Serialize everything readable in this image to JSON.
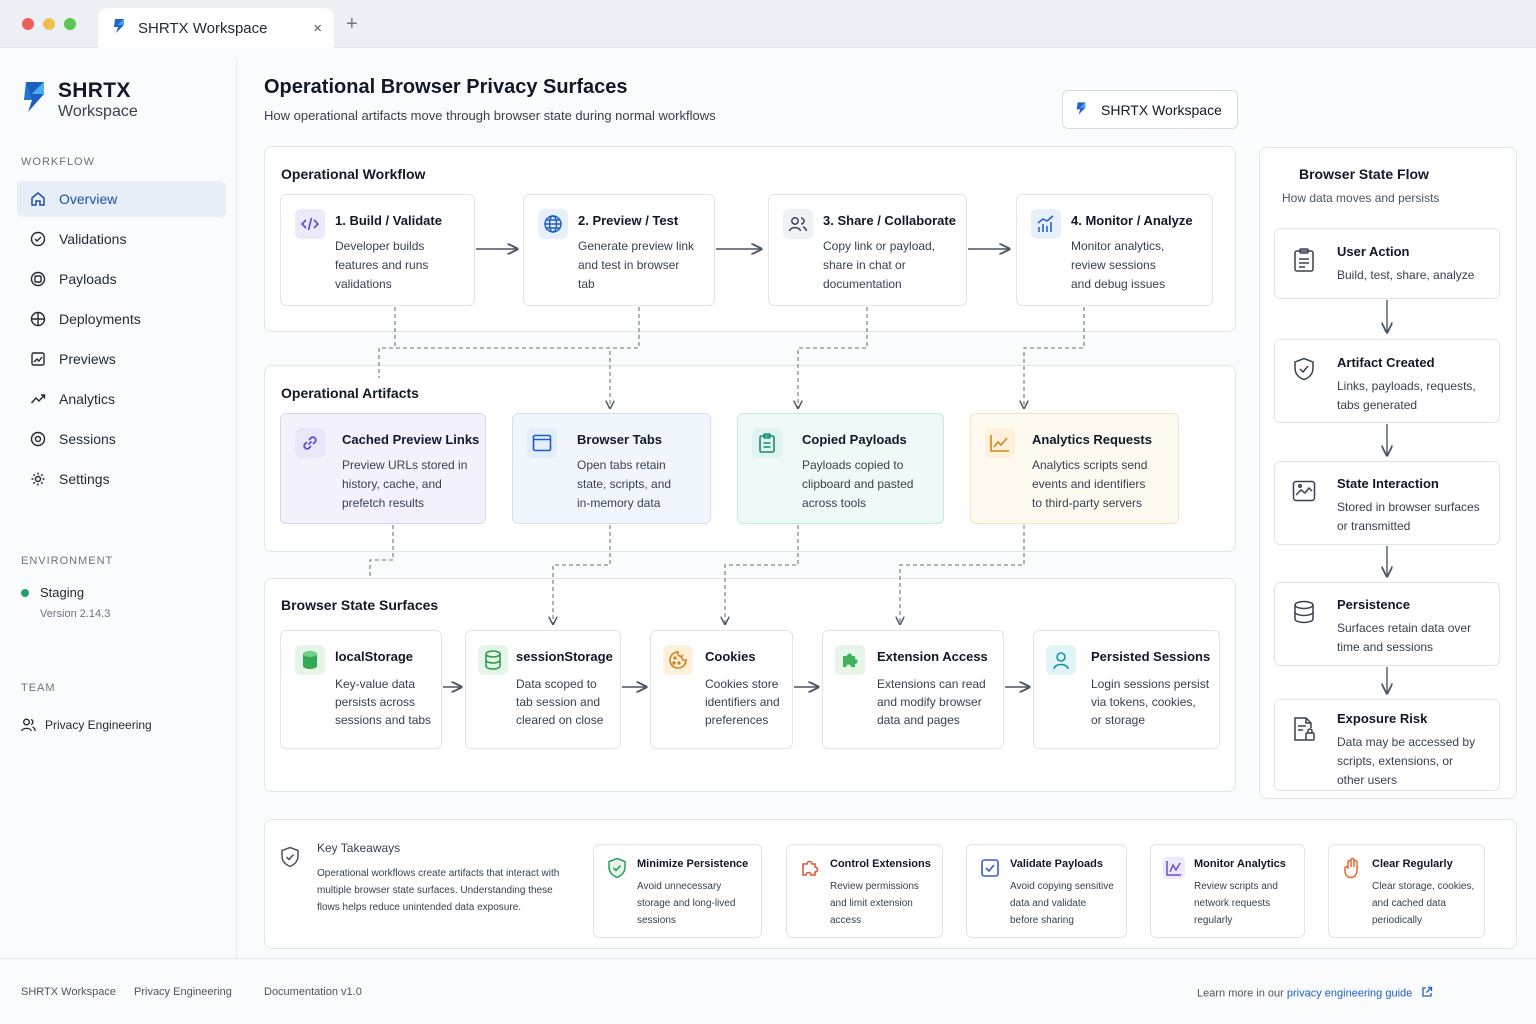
{
  "browser": {
    "tab_title": "SHRTX Workspace",
    "close": "×",
    "new_tab": "+"
  },
  "brand": {
    "name": "SHRTX",
    "sub": "Workspace"
  },
  "sidebar": {
    "workflow_label": "WORKFLOW",
    "items": [
      {
        "label": "Overview",
        "icon": "home-icon"
      },
      {
        "label": "Validations",
        "icon": "check-circle-icon"
      },
      {
        "label": "Payloads",
        "icon": "package-icon"
      },
      {
        "label": "Deployments",
        "icon": "globe-icon"
      },
      {
        "label": "Previews",
        "icon": "preview-icon"
      },
      {
        "label": "Analytics",
        "icon": "trend-icon"
      },
      {
        "label": "Sessions",
        "icon": "target-icon"
      },
      {
        "label": "Settings",
        "icon": "gear-icon"
      }
    ],
    "environment_label": "ENVIRONMENT",
    "env_name": "Staging",
    "env_version": "Version 2.14.3",
    "team_label": "TEAM",
    "team_name": "Privacy Engineering"
  },
  "header": {
    "title": "Operational Browser Privacy Surfaces",
    "subtitle": "How operational artifacts move through browser state during normal workflows",
    "workspace_button": "SHRTX Workspace"
  },
  "workflow": {
    "title": "Operational Workflow",
    "steps": [
      {
        "title": "1. Build / Validate",
        "lines": [
          "Developer builds",
          "features and runs",
          "validations"
        ]
      },
      {
        "title": "2. Preview / Test",
        "lines": [
          "Generate preview link",
          "and test in browser",
          "tab"
        ]
      },
      {
        "title": "3. Share / Collaborate",
        "lines": [
          "Copy link or payload,",
          "share in chat or",
          "documentation"
        ]
      },
      {
        "title": "4. Monitor / Analyze",
        "lines": [
          "Monitor analytics,",
          "review sessions",
          "and debug issues"
        ]
      }
    ]
  },
  "artifacts": {
    "title": "Operational Artifacts",
    "items": [
      {
        "title": "Cached Preview Links",
        "lines": [
          "Preview URLs stored in",
          "history, cache, and",
          "prefetch results"
        ]
      },
      {
        "title": "Browser Tabs",
        "lines": [
          "Open tabs retain",
          "state, scripts, and",
          "in-memory data"
        ]
      },
      {
        "title": "Copied Payloads",
        "lines": [
          "Payloads copied to",
          "clipboard and pasted",
          "across tools"
        ]
      },
      {
        "title": "Analytics Requests",
        "lines": [
          "Analytics scripts send",
          "events and identifiers",
          "to third-party servers"
        ]
      }
    ]
  },
  "surfaces": {
    "title": "Browser State Surfaces",
    "items": [
      {
        "title": "localStorage",
        "lines": [
          "Key-value data",
          "persists across",
          "sessions and tabs"
        ]
      },
      {
        "title": "sessionStorage",
        "lines": [
          "Data scoped to",
          "tab session and",
          "cleared on close"
        ]
      },
      {
        "title": "Cookies",
        "lines": [
          "Cookies store",
          "identifiers and",
          "preferences"
        ]
      },
      {
        "title": "Extension Access",
        "lines": [
          "Extensions can read",
          "and modify browser",
          "data and pages"
        ]
      },
      {
        "title": "Persisted Sessions",
        "lines": [
          "Login sessions persist",
          "via tokens, cookies,",
          "or storage"
        ]
      }
    ]
  },
  "state_flow": {
    "title": "Browser State Flow",
    "subtitle": "How data moves and persists",
    "items": [
      {
        "title": "User Action",
        "lines": [
          "Build, test, share, analyze"
        ]
      },
      {
        "title": "Artifact Created",
        "lines": [
          "Links, payloads, requests,",
          "tabs generated"
        ]
      },
      {
        "title": "State Interaction",
        "lines": [
          "Stored in browser surfaces",
          "or transmitted"
        ]
      },
      {
        "title": "Persistence",
        "lines": [
          "Surfaces retain data over",
          "time and sessions"
        ]
      },
      {
        "title": "Exposure Risk",
        "lines": [
          "Data may be accessed by",
          "scripts, extensions, or",
          "other users"
        ]
      }
    ]
  },
  "takeaways": {
    "title": "Key Takeaways",
    "lines": [
      "Operational workflows create artifacts that interact with",
      "multiple browser state surfaces. Understanding these",
      "flows helps reduce unintended data exposure."
    ],
    "items": [
      {
        "title": "Minimize Persistence",
        "lines": [
          "Avoid unnecessary",
          "storage and long-lived",
          "sessions"
        ]
      },
      {
        "title": "Control Extensions",
        "lines": [
          "Review permissions",
          "and limit extension",
          "access"
        ]
      },
      {
        "title": "Validate Payloads",
        "lines": [
          "Avoid copying sensitive",
          "data and validate",
          "before sharing"
        ]
      },
      {
        "title": "Monitor Analytics",
        "lines": [
          "Review scripts and",
          "network requests",
          "regularly"
        ]
      },
      {
        "title": "Clear Regularly",
        "lines": [
          "Clear storage, cookies,",
          "and cached data",
          "periodically"
        ]
      }
    ]
  },
  "footer": {
    "workspace": "SHRTX Workspace",
    "team": "Privacy Engineering",
    "docs": "Documentation v1.0",
    "learn_prefix": "Learn more in our",
    "learn_link": "privacy engineering guide"
  }
}
